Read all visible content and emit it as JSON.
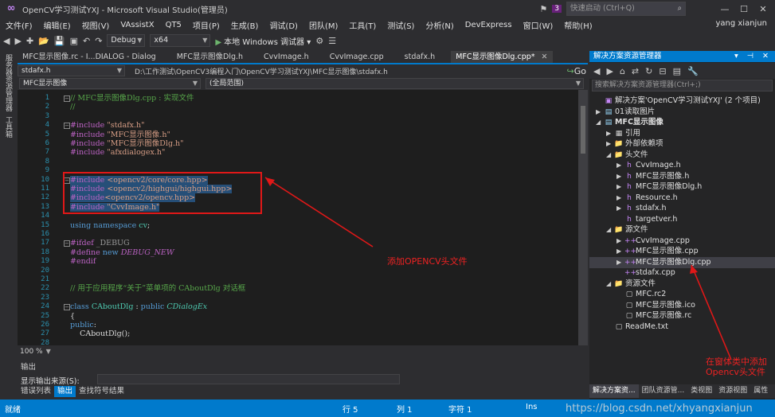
{
  "window": {
    "title": "OpenCV学习测试YXJ - Microsoft Visual Studio(管理员)",
    "notification_count": "3",
    "quick_launch_placeholder": "快速启动 (Ctrl+Q)"
  },
  "menu": [
    "文件(F)",
    "编辑(E)",
    "视图(V)",
    "VAssistX",
    "QT5",
    "项目(P)",
    "生成(B)",
    "调试(D)",
    "团队(M)",
    "工具(T)",
    "测试(S)",
    "分析(N)",
    "DevExpress",
    "窗口(W)",
    "帮助(H)"
  ],
  "user": "yang xianjun",
  "toolbar": {
    "config": "Debug",
    "platform": "x64",
    "run_label": "本地 Windows 调试器"
  },
  "left_tools": [
    "服务器资源管理器",
    "工具箱"
  ],
  "doc_tabs": [
    {
      "label": "MFC显示图像.rc - I...DIALOG - Dialog",
      "active": false
    },
    {
      "label": "MFC显示图像Dlg.h",
      "active": false
    },
    {
      "label": "CvvImage.h",
      "active": false
    },
    {
      "label": "CvvImage.cpp",
      "active": false
    },
    {
      "label": "stdafx.h",
      "active": false
    },
    {
      "label": "MFC显示图像Dlg.cpp*",
      "active": true
    }
  ],
  "nav": {
    "file_combo": "stdafx.h",
    "path": "D:\\工作测试\\OpenCV3编程入门\\OpenCV学习测试YXJ\\MFC显示图像\\stdafx.h",
    "go_label": "Go",
    "project_combo": "MFC显示图像",
    "scope_combo": "(全局范围)"
  },
  "code_lines": [
    {
      "n": "1",
      "html": "<span class=\"cm\">// MFC显示图像Dlg.cpp : 实现文件</span>"
    },
    {
      "n": "2",
      "html": "<span class=\"cm\">//</span>"
    },
    {
      "n": "3",
      "html": ""
    },
    {
      "n": "4",
      "html": "<span class=\"mac\">#include</span> <span class=\"str\">\"stdafx.h\"</span>"
    },
    {
      "n": "5",
      "html": "<span class=\"mac\">#include</span> <span class=\"str\">\"MFC显示图像.h\"</span>"
    },
    {
      "n": "6",
      "html": "<span class=\"mac\">#include</span> <span class=\"str\">\"MFC显示图像Dlg.h\"</span>"
    },
    {
      "n": "7",
      "html": "<span class=\"mac\">#include</span> <span class=\"str\">\"afxdialogex.h\"</span>"
    },
    {
      "n": "8",
      "html": ""
    },
    {
      "n": "9",
      "html": ""
    },
    {
      "n": "10",
      "html": "<span class=\"hl\"><span class=\"mac\">#include</span> <span class=\"str\">&lt;opencv2/core/core.hpp&gt;</span></span>"
    },
    {
      "n": "11",
      "html": "<span class=\"hl\"><span class=\"mac\">#include</span> <span class=\"str\">&lt;opencv2/highgui/highgui.hpp&gt;</span></span>"
    },
    {
      "n": "12",
      "html": "<span class=\"hl\"><span class=\"mac\">#include</span><span class=\"str\">&lt;opencv2/opencv.hpp&gt;</span></span>"
    },
    {
      "n": "13",
      "html": "<span class=\"hl\"><span class=\"mac\">#include</span> <span class=\"str\">\"CvvImage.h\"</span></span>"
    },
    {
      "n": "14",
      "html": ""
    },
    {
      "n": "15",
      "html": "<span class=\"kw\">using namespace</span> <span class=\"ty\">cv</span>;"
    },
    {
      "n": "16",
      "html": ""
    },
    {
      "n": "17",
      "html": "<span class=\"mac\">#ifdef</span> <span class=\"inc\">_DEBUG</span>"
    },
    {
      "n": "18",
      "html": "<span class=\"mac\">#define</span> <span class=\"kw\">new</span> <span class=\"mac\"><i>DEBUG_NEW</i></span>"
    },
    {
      "n": "19",
      "html": "<span class=\"mac\">#endif</span>"
    },
    {
      "n": "20",
      "html": ""
    },
    {
      "n": "21",
      "html": ""
    },
    {
      "n": "22",
      "html": "<span class=\"cm\">// 用于应用程序“关于”菜单项的 CAboutDlg 对话框</span>"
    },
    {
      "n": "23",
      "html": ""
    },
    {
      "n": "24",
      "html": "<span class=\"kw\">class</span> <span class=\"ty\">CAboutDlg</span> : <span class=\"kw\">public</span> <span class=\"ty\"><i>CDialogEx</i></span>"
    },
    {
      "n": "25",
      "html": "{"
    },
    {
      "n": "26",
      "html": "<span class=\"kw\">public</span>:"
    },
    {
      "n": "27",
      "html": "    CAboutDlg();"
    },
    {
      "n": "28",
      "html": ""
    }
  ],
  "annotations": {
    "editor_note": "添加OPENCV头文件",
    "tree_note": "在窗体类中添加Opencv头文件"
  },
  "zoom": "100 %",
  "output": {
    "title": "输出",
    "source_label": "显示输出来源(S):",
    "tabs": [
      "错误列表",
      "输出",
      "查找符号结果"
    ],
    "active_tab": 1
  },
  "solution": {
    "title": "解决方案资源管理器",
    "search_placeholder": "搜索解决方案资源管理器(Ctrl+;)",
    "tree": [
      {
        "label": "解决方案'OpenCV学习测试YXJ' (2 个项目)",
        "icon": "solution",
        "depth": 0,
        "tw": ""
      },
      {
        "label": "01读取图片",
        "icon": "project",
        "depth": 0,
        "tw": "▶"
      },
      {
        "label": "MFC显示图像",
        "icon": "project",
        "depth": 0,
        "tw": "◢",
        "bold": true
      },
      {
        "label": "引用",
        "icon": "ref",
        "depth": 1,
        "tw": "▶"
      },
      {
        "label": "外部依赖项",
        "icon": "folder",
        "depth": 1,
        "tw": "▶"
      },
      {
        "label": "头文件",
        "icon": "folder",
        "depth": 1,
        "tw": "◢"
      },
      {
        "label": "CvvImage.h",
        "icon": "h",
        "depth": 2,
        "tw": "▶"
      },
      {
        "label": "MFC显示图像.h",
        "icon": "h",
        "depth": 2,
        "tw": "▶"
      },
      {
        "label": "MFC显示图像Dlg.h",
        "icon": "h",
        "depth": 2,
        "tw": "▶"
      },
      {
        "label": "Resource.h",
        "icon": "h",
        "depth": 2,
        "tw": "▶"
      },
      {
        "label": "stdafx.h",
        "icon": "h",
        "depth": 2,
        "tw": "▶"
      },
      {
        "label": "targetver.h",
        "icon": "h",
        "depth": 2,
        "tw": ""
      },
      {
        "label": "源文件",
        "icon": "folder",
        "depth": 1,
        "tw": "◢"
      },
      {
        "label": "CvvImage.cpp",
        "icon": "cpp",
        "depth": 2,
        "tw": "▶"
      },
      {
        "label": "MFC显示图像.cpp",
        "icon": "cpp",
        "depth": 2,
        "tw": "▶"
      },
      {
        "label": "MFC显示图像Dlg.cpp",
        "icon": "cpp",
        "depth": 2,
        "tw": "▶",
        "selected": true
      },
      {
        "label": "stdafx.cpp",
        "icon": "cpp",
        "depth": 2,
        "tw": ""
      },
      {
        "label": "资源文件",
        "icon": "folder",
        "depth": 1,
        "tw": "◢"
      },
      {
        "label": "MFC.rc2",
        "icon": "file",
        "depth": 2,
        "tw": ""
      },
      {
        "label": "MFC显示图像.ico",
        "icon": "file",
        "depth": 2,
        "tw": ""
      },
      {
        "label": "MFC显示图像.rc",
        "icon": "file",
        "depth": 2,
        "tw": ""
      },
      {
        "label": "ReadMe.txt",
        "icon": "file",
        "depth": 1,
        "tw": ""
      }
    ],
    "tabs": [
      "解决方案资...",
      "团队资源管...",
      "类视图",
      "资源视图",
      "属性"
    ]
  },
  "status": {
    "ready": "就绪",
    "row": "行 5",
    "col": "列 1",
    "char": "字符 1",
    "mode": "Ins"
  },
  "watermark": "https://blog.csdn.net/xhyangxianjun"
}
